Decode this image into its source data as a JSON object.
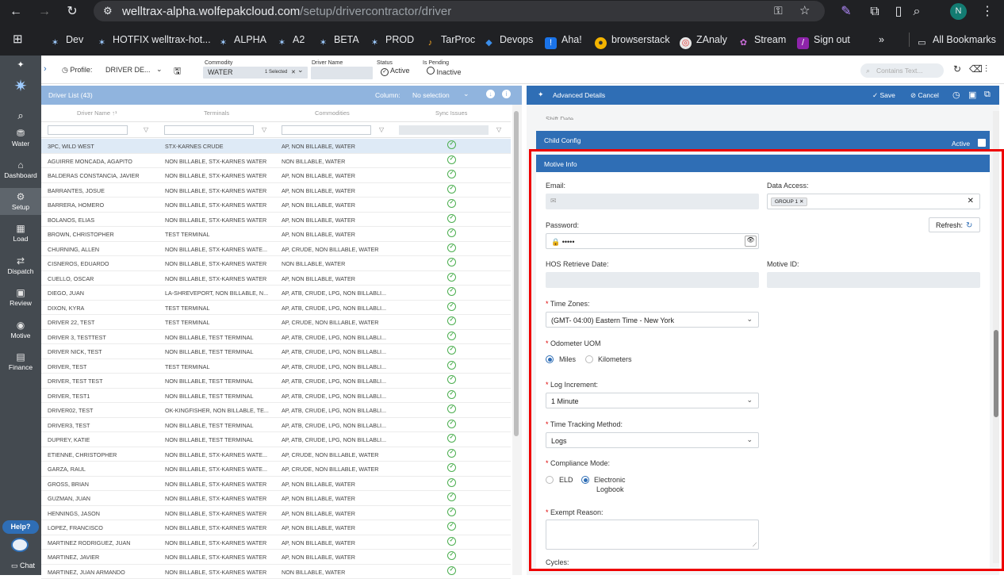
{
  "browser": {
    "url_host": "welltrax-alpha.wolfepakcloud.com",
    "url_path": "/setup/drivercontractor/driver",
    "avatar": "N"
  },
  "bookmarks": [
    "Dev",
    "HOTFIX welltrax-hot...",
    "ALPHA",
    "A2",
    "BETA",
    "PROD",
    "TarProc",
    "Devops",
    "Aha!",
    "browserstack",
    "ZAnaly",
    "Stream",
    "Sign out",
    "»",
    "All Bookmarks"
  ],
  "nav": [
    {
      "label": "Water"
    },
    {
      "label": "Dashboard"
    },
    {
      "label": "Setup"
    },
    {
      "label": "Load"
    },
    {
      "label": "Dispatch"
    },
    {
      "label": "Review"
    },
    {
      "label": "Motive"
    },
    {
      "label": "Finance"
    }
  ],
  "help": "Help?",
  "chat": "Chat",
  "toolbar": {
    "profile_label": "Profile:",
    "profile_value": "DRIVER DE...",
    "commodity_label": "Commodity",
    "commodity_value": "WATER",
    "commodity_selected": "1 Selected",
    "driver_name_label": "Driver Name",
    "status_label": "Status",
    "active": "Active",
    "pending_label": "Is Pending",
    "inactive": "Inactive",
    "search_placeholder": "Contains Text..."
  },
  "list": {
    "title": "Driver List (43)",
    "column_label": "Column:",
    "column_value": "No selection",
    "headers": [
      "Driver Name",
      "Terminals",
      "Commodities",
      "Sync Issues"
    ],
    "sort": "↑¹",
    "rows": [
      [
        "3PC, WILD WEST",
        "STX-KARNES CRUDE",
        "AP, NON BILLABLE, WATER"
      ],
      [
        "AGUIRRE MONCADA, AGAPITO",
        "NON BILLABLE, STX-KARNES WATER",
        "NON BILLABLE, WATER"
      ],
      [
        "BALDERAS CONSTANCIA, JAVIER",
        "NON BILLABLE, STX-KARNES WATER",
        "AP, NON BILLABLE, WATER"
      ],
      [
        "BARRANTES, JOSUE",
        "NON BILLABLE, STX-KARNES WATER",
        "AP, NON BILLABLE, WATER"
      ],
      [
        "BARRERA, HOMERO",
        "NON BILLABLE, STX-KARNES WATER",
        "AP, NON BILLABLE, WATER"
      ],
      [
        "BOLANOS, ELIAS",
        "NON BILLABLE, STX-KARNES WATER",
        "AP, NON BILLABLE, WATER"
      ],
      [
        "BROWN, CHRISTOPHER",
        "TEST TERMINAL",
        "AP, NON BILLABLE, WATER"
      ],
      [
        "CHURNING, ALLEN",
        "NON BILLABLE, STX-KARNES WATE...",
        "AP, CRUDE, NON BILLABLE, WATER"
      ],
      [
        "CISNEROS, EDUARDO",
        "NON BILLABLE, STX-KARNES WATER",
        "NON BILLABLE, WATER"
      ],
      [
        "CUELLO, OSCAR",
        "NON BILLABLE, STX-KARNES WATER",
        "AP, NON BILLABLE, WATER"
      ],
      [
        "DIEGO, JUAN",
        "LA-SHREVEPORT, NON BILLABLE, N...",
        "AP, ATB, CRUDE, LPG, NON BILLABLI..."
      ],
      [
        "DIXON, KYRA",
        "TEST TERMINAL",
        "AP, ATB, CRUDE, LPG, NON BILLABLI..."
      ],
      [
        "DRIVER 22, TEST",
        "TEST TERMINAL",
        "AP, CRUDE, NON BILLABLE, WATER"
      ],
      [
        "DRIVER 3, TESTTEST",
        "NON BILLABLE, TEST TERMINAL",
        "AP, ATB, CRUDE, LPG, NON BILLABLI..."
      ],
      [
        "DRIVER NICK, TEST",
        "NON BILLABLE, TEST TERMINAL",
        "AP, ATB, CRUDE, LPG, NON BILLABLI..."
      ],
      [
        "DRIVER, TEST",
        "TEST TERMINAL",
        "AP, ATB, CRUDE, LPG, NON BILLABLI..."
      ],
      [
        "DRIVER, TEST TEST",
        "NON BILLABLE, TEST TERMINAL",
        "AP, ATB, CRUDE, LPG, NON BILLABLI..."
      ],
      [
        "DRIVER, TEST1",
        "NON BILLABLE, TEST TERMINAL",
        "AP, ATB, CRUDE, LPG, NON BILLABLI..."
      ],
      [
        "DRIVER02, TEST",
        "OK-KINGFISHER, NON BILLABLE, TE...",
        "AP, ATB, CRUDE, LPG, NON BILLABLI..."
      ],
      [
        "DRIVER3, TEST",
        "NON BILLABLE, TEST TERMINAL",
        "AP, ATB, CRUDE, LPG, NON BILLABLI..."
      ],
      [
        "DUPREY, KATIE",
        "NON BILLABLE, TEST TERMINAL",
        "AP, ATB, CRUDE, LPG, NON BILLABLI..."
      ],
      [
        "ETIENNE, CHRISTOPHER",
        "NON BILLABLE, STX-KARNES WATE...",
        "AP, CRUDE, NON BILLABLE, WATER"
      ],
      [
        "GARZA, RAUL",
        "NON BILLABLE, STX-KARNES WATE...",
        "AP, CRUDE, NON BILLABLE, WATER"
      ],
      [
        "GROSS, BRIAN",
        "NON BILLABLE, STX-KARNES WATER",
        "AP, NON BILLABLE, WATER"
      ],
      [
        "GUZMAN, JUAN",
        "NON BILLABLE, STX-KARNES WATER",
        "AP, NON BILLABLE, WATER"
      ],
      [
        "HENNINGS, JASON",
        "NON BILLABLE, STX-KARNES WATER",
        "AP, NON BILLABLE, WATER"
      ],
      [
        "LOPEZ, FRANCISCO",
        "NON BILLABLE, STX-KARNES WATER",
        "AP, NON BILLABLE, WATER"
      ],
      [
        "MARTINEZ RODRIGUEZ, JUAN",
        "NON BILLABLE, STX-KARNES WATER",
        "AP, NON BILLABLE, WATER"
      ],
      [
        "MARTINEZ, JAVIER",
        "NON BILLABLE, STX-KARNES WATER",
        "AP, NON BILLABLE, WATER"
      ],
      [
        "MARTINEZ, JUAN ARMANDO",
        "NON BILLABLE, STX-KARNES WATER",
        "NON BILLABLE, WATER"
      ]
    ]
  },
  "details": {
    "title": "Advanced Details",
    "save": "Save",
    "cancel": "Cancel",
    "cut_label": "Shift Date",
    "child_config": "Child Config",
    "active": "Active",
    "motive_info": "Motive Info",
    "email_label": "Email:",
    "data_access_label": "Data Access:",
    "data_access_tag": "GROUP 1",
    "password_label": "Password:",
    "password_value": "•••••",
    "refresh": "Refresh:",
    "hos_label": "HOS Retrieve Date:",
    "motive_id_label": "Motive ID:",
    "tz_label": "Time Zones:",
    "tz_value": "(GMT- 04:00) Eastern Time - New York",
    "odo_label": "Odometer UOM",
    "miles": "Miles",
    "km": "Kilometers",
    "log_label": "Log Increment:",
    "log_value": "1 Minute",
    "ttm_label": "Time Tracking Method:",
    "ttm_value": "Logs",
    "comp_label": "Compliance Mode:",
    "eld": "ELD",
    "electronic": "Electronic",
    "logbook": "Logbook",
    "exempt_label": "Exempt Reason:",
    "cycles_label": "Cycles:"
  }
}
